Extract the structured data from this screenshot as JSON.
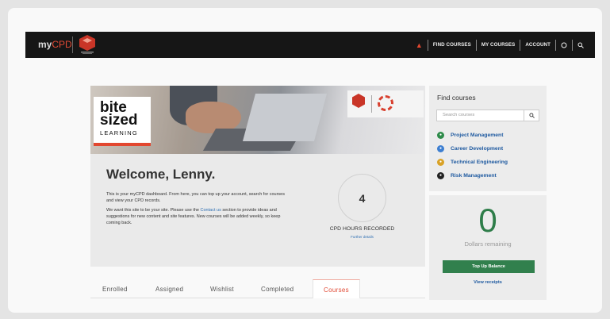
{
  "header": {
    "logo_prefix": "my",
    "logo_suffix": "CPD",
    "nav": [
      {
        "label": "FIND COURSES"
      },
      {
        "label": "MY COURSES"
      },
      {
        "label": "ACCOUNT"
      }
    ],
    "icons": [
      "home-icon",
      "user-icon",
      "search-icon"
    ]
  },
  "hero": {
    "line1": "bite",
    "line2": "sized",
    "line3": "LEARNING"
  },
  "welcome": {
    "title": "Welcome, Lenny.",
    "para1": "This is your myCPD dashboard. From here, you can top up your account, search for courses and view your CPD records.",
    "para2_before": "We want this site to be your site. Please use the ",
    "para2_link": "Contact us",
    "para2_after": " section to provide ideas and suggestions for new content and site features. New courses will be added weekly, so keep coming back."
  },
  "cpd": {
    "hours": "4",
    "label": "CPD HOURS RECORDED",
    "details_link": "Further details"
  },
  "tabs": [
    {
      "label": "Enrolled"
    },
    {
      "label": "Assigned"
    },
    {
      "label": "Wishlist"
    },
    {
      "label": "Completed"
    },
    {
      "label": "Courses",
      "active": true
    }
  ],
  "find_courses": {
    "title": "Find courses",
    "search_placeholder": "Search courses",
    "categories": [
      {
        "label": "Project Management",
        "icon": "project-icon",
        "color": "#2e8b4a"
      },
      {
        "label": "Career Development",
        "icon": "career-icon",
        "color": "#3d7fd1"
      },
      {
        "label": "Technical Engineering",
        "icon": "gear-icon",
        "color": "#d9a227"
      },
      {
        "label": "Risk Management",
        "icon": "risk-icon",
        "color": "#222222"
      }
    ]
  },
  "balance": {
    "amount": "0",
    "label": "Dollars remaining",
    "topup_label": "Top Up Balance",
    "receipts_label": "View receipts"
  },
  "colors": {
    "accent_red": "#e14a35",
    "link_blue": "#1f5aa0",
    "green": "#31804d"
  }
}
